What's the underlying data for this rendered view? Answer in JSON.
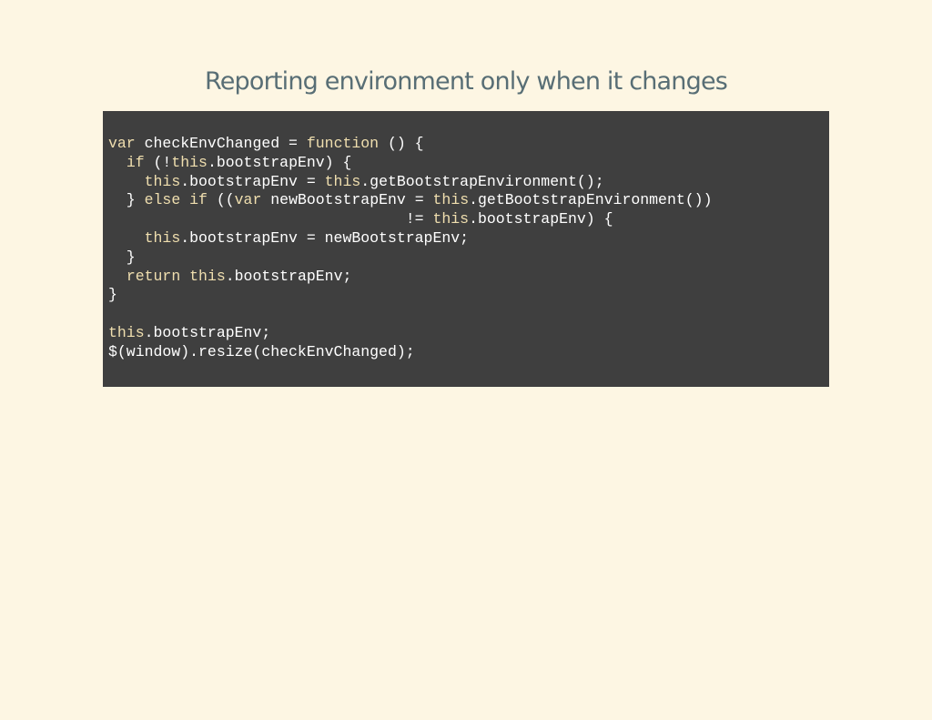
{
  "slide": {
    "title": "Reporting environment only when it changes"
  },
  "code": {
    "lines": [
      [
        {
          "t": "var",
          "k": 1
        },
        {
          "t": " checkEnvChanged = ",
          "k": 0
        },
        {
          "t": "function",
          "k": 1
        },
        {
          "t": " () {",
          "k": 0
        }
      ],
      [
        {
          "t": "  ",
          "k": 0
        },
        {
          "t": "if",
          "k": 1
        },
        {
          "t": " (!",
          "k": 0
        },
        {
          "t": "this",
          "k": 1
        },
        {
          "t": ".bootstrapEnv) {",
          "k": 0
        }
      ],
      [
        {
          "t": "    ",
          "k": 0
        },
        {
          "t": "this",
          "k": 1
        },
        {
          "t": ".bootstrapEnv = ",
          "k": 0
        },
        {
          "t": "this",
          "k": 1
        },
        {
          "t": ".getBootstrapEnvironment();",
          "k": 0
        }
      ],
      [
        {
          "t": "  } ",
          "k": 0
        },
        {
          "t": "else",
          "k": 1
        },
        {
          "t": " ",
          "k": 0
        },
        {
          "t": "if",
          "k": 1
        },
        {
          "t": " ((",
          "k": 0
        },
        {
          "t": "var",
          "k": 1
        },
        {
          "t": " newBootstrapEnv = ",
          "k": 0
        },
        {
          "t": "this",
          "k": 1
        },
        {
          "t": ".getBootstrapEnvironment())",
          "k": 0
        }
      ],
      [
        {
          "t": "                                 != ",
          "k": 0
        },
        {
          "t": "this",
          "k": 1
        },
        {
          "t": ".bootstrapEnv) {",
          "k": 0
        }
      ],
      [
        {
          "t": "    ",
          "k": 0
        },
        {
          "t": "this",
          "k": 1
        },
        {
          "t": ".bootstrapEnv = newBootstrapEnv;",
          "k": 0
        }
      ],
      [
        {
          "t": "  }",
          "k": 0
        }
      ],
      [
        {
          "t": "  ",
          "k": 0
        },
        {
          "t": "return",
          "k": 1
        },
        {
          "t": " ",
          "k": 0
        },
        {
          "t": "this",
          "k": 1
        },
        {
          "t": ".bootstrapEnv;",
          "k": 0
        }
      ],
      [
        {
          "t": "}",
          "k": 0
        }
      ],
      [],
      [
        {
          "t": "this",
          "k": 1
        },
        {
          "t": ".bootstrapEnv;",
          "k": 0
        }
      ],
      [
        {
          "t": "$(window).resize(checkEnvChanged);",
          "k": 0
        }
      ]
    ]
  },
  "colors": {
    "background": "#fdf6e3",
    "title": "#586e75",
    "code_background": "#3f3f3f",
    "code_text": "#ffffff",
    "code_keyword": "#f0dfaf"
  }
}
